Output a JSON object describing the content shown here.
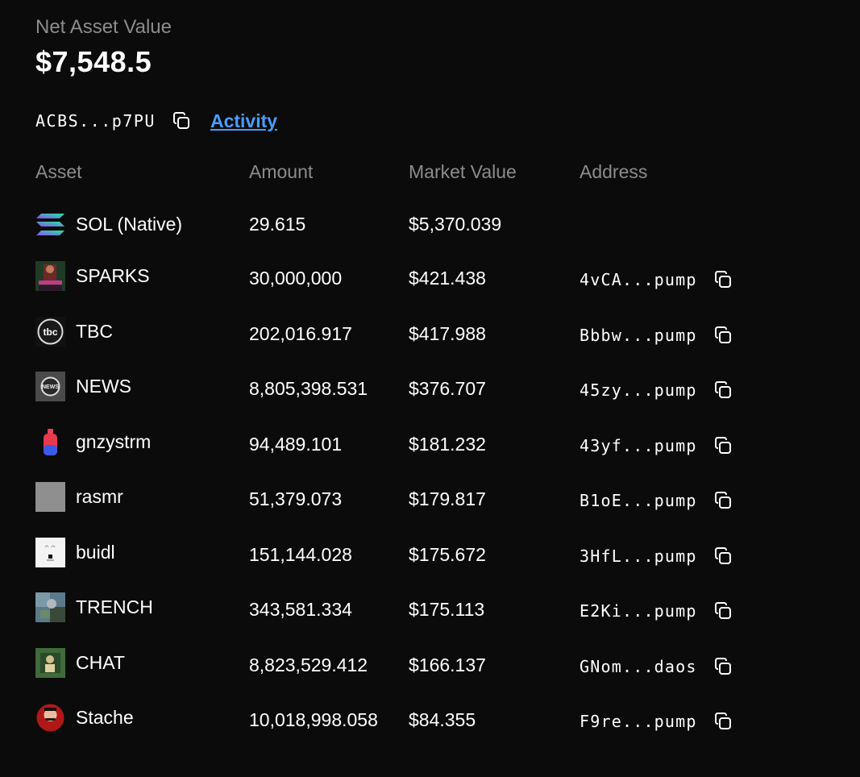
{
  "header": {
    "nav_label": "Net Asset Value",
    "nav_value": "$7,548.5",
    "wallet_address": "ACBS...p7PU",
    "activity_label": "Activity"
  },
  "table": {
    "columns": [
      "Asset",
      "Amount",
      "Market Value",
      "Address"
    ],
    "rows": [
      {
        "name": "SOL (Native)",
        "amount": "29.615",
        "value": "$5,370.039",
        "address": "",
        "icon": "solana-logo-icon"
      },
      {
        "name": "SPARKS",
        "amount": "30,000,000",
        "value": "$421.438",
        "address": "4vCA...pump",
        "icon": "sparks-token-icon"
      },
      {
        "name": "TBC",
        "amount": "202,016.917",
        "value": "$417.988",
        "address": "Bbbw...pump",
        "icon": "tbc-token-icon"
      },
      {
        "name": "NEWS",
        "amount": "8,805,398.531",
        "value": "$376.707",
        "address": "45zy...pump",
        "icon": "news-token-icon"
      },
      {
        "name": "gnzystrm",
        "amount": "94,489.101",
        "value": "$181.232",
        "address": "43yf...pump",
        "icon": "gnzystrm-token-icon"
      },
      {
        "name": "rasmr",
        "amount": "51,379.073",
        "value": "$179.817",
        "address": "B1oE...pump",
        "icon": "rasmr-token-icon"
      },
      {
        "name": "buidl",
        "amount": "151,144.028",
        "value": "$175.672",
        "address": "3HfL...pump",
        "icon": "buidl-token-icon"
      },
      {
        "name": "TRENCH",
        "amount": "343,581.334",
        "value": "$175.113",
        "address": "E2Ki...pump",
        "icon": "trench-token-icon"
      },
      {
        "name": "CHAT",
        "amount": "8,823,529.412",
        "value": "$166.137",
        "address": "GNom...daos",
        "icon": "chat-token-icon"
      },
      {
        "name": "Stache",
        "amount": "10,018,998.058",
        "value": "$84.355",
        "address": "F9re...pump",
        "icon": "stache-token-icon"
      }
    ]
  },
  "colors": {
    "background": "#0b0b0b",
    "muted_text": "#8c8c8c",
    "link": "#4a9cff",
    "text": "#ffffff"
  }
}
